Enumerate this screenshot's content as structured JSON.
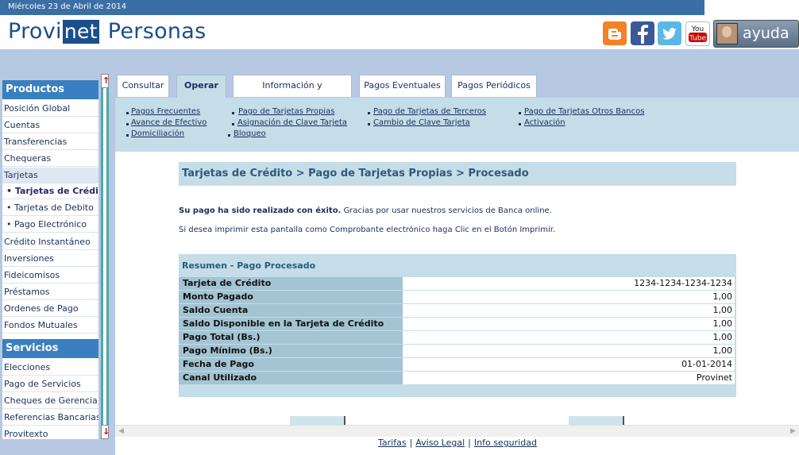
{
  "header": {
    "date": "Miércoles 23 de Abril de 2014",
    "logo_prefix": "Provi",
    "logo_highlight": "net",
    "logo_suffix": "Personas",
    "help_label": "ayuda",
    "social_icons": [
      "blogger-icon",
      "facebook-icon",
      "twitter-icon",
      "youtube-icon"
    ]
  },
  "sidebar": {
    "products_title": "Productos",
    "products": [
      "Posición Global",
      "Cuentas",
      "Transferencias",
      "Chequeras",
      "Tarjetas",
      "• Tarjetas de Crédito",
      "• Tarjetas de Debito",
      "• Pago Electrónico",
      "Crédito Instantáneo",
      "Inversiones",
      "Fideicomisos",
      "Préstamos",
      "Ordenes de Pago",
      "Fondos Mutuales"
    ],
    "services_title": "Servicios",
    "services": [
      "Elecciones",
      "Pago de Servicios",
      "Cheques de Gerencia",
      "Referencias Bancarias",
      "Provitexto"
    ]
  },
  "tabs": [
    "Consultar",
    "Operar",
    "Información y contratación",
    "Pagos Eventuales",
    "Pagos Periódicos"
  ],
  "submenu": [
    [
      "Pagos Frecuentes",
      "Avance de Efectivo",
      "Domiciliación"
    ],
    [
      "Pago de Tarjetas Propias",
      "Asignación de Clave Tarjeta",
      "Bloqueo"
    ],
    [
      "Pago de Tarjetas de Terceros",
      "Cambio de Clave Tarjeta"
    ],
    [
      "Pago de Tarjetas Otros Bancos",
      "Activación"
    ]
  ],
  "breadcrumb": "Tarjetas de Crédito > Pago de Tarjetas Propias > Procesado",
  "messages": {
    "success_bold": "Su pago ha sido realizado con éxito.",
    "success_rest": "Gracias por usar nuestros servicios de Banca online.",
    "print_hint": "Si desea imprimir esta pantalla como Comprobante electrónico haga Clic en el Botón Imprimir."
  },
  "summary": {
    "title": "Resumen - Pago Procesado",
    "rows": [
      {
        "label": "Tarjeta de Crédito",
        "value": "1234-1234-1234-1234"
      },
      {
        "label": "Monto Pagado",
        "value": "1,00"
      },
      {
        "label": "Saldo Cuenta",
        "value": "1,00"
      },
      {
        "label": "Saldo Disponible en la Tarjeta de Crédito",
        "value": "1,00"
      },
      {
        "label": "Pago Total (Bs.)",
        "value": "1,00"
      },
      {
        "label": "Pago Mínimo (Bs.)",
        "value": "1,00"
      },
      {
        "label": "Fecha de Pago",
        "value": "01-01-2014"
      },
      {
        "label": "Canal Utilizado",
        "value": "Provinet"
      }
    ]
  },
  "footer": {
    "links": [
      "Tarifas",
      "Aviso Legal",
      "Info seguridad"
    ]
  }
}
